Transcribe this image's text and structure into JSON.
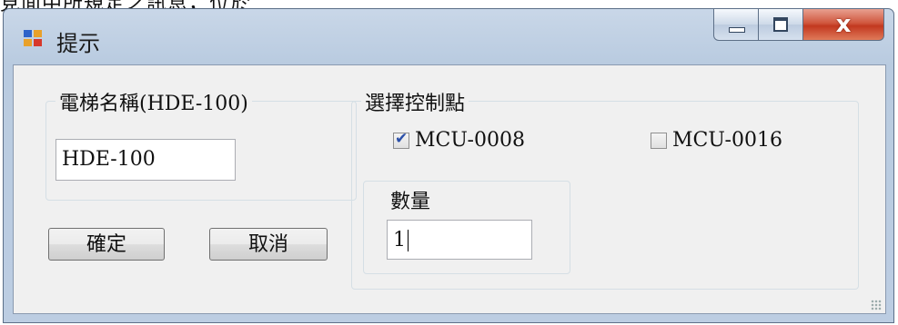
{
  "window": {
    "title": "提示",
    "partial_top_text": "見面中所規定之訊息，位於"
  },
  "elevator_group": {
    "legend": "電梯名稱(HDE-100)",
    "name_value": "HDE-100"
  },
  "control_group": {
    "legend": "選擇控制點",
    "options": [
      {
        "label": "MCU-0008",
        "checked": true
      },
      {
        "label": "MCU-0016",
        "checked": false
      }
    ],
    "quantity_legend": "數量",
    "quantity_value": "1"
  },
  "buttons": {
    "ok_label": "確定",
    "cancel_label": "取消"
  }
}
